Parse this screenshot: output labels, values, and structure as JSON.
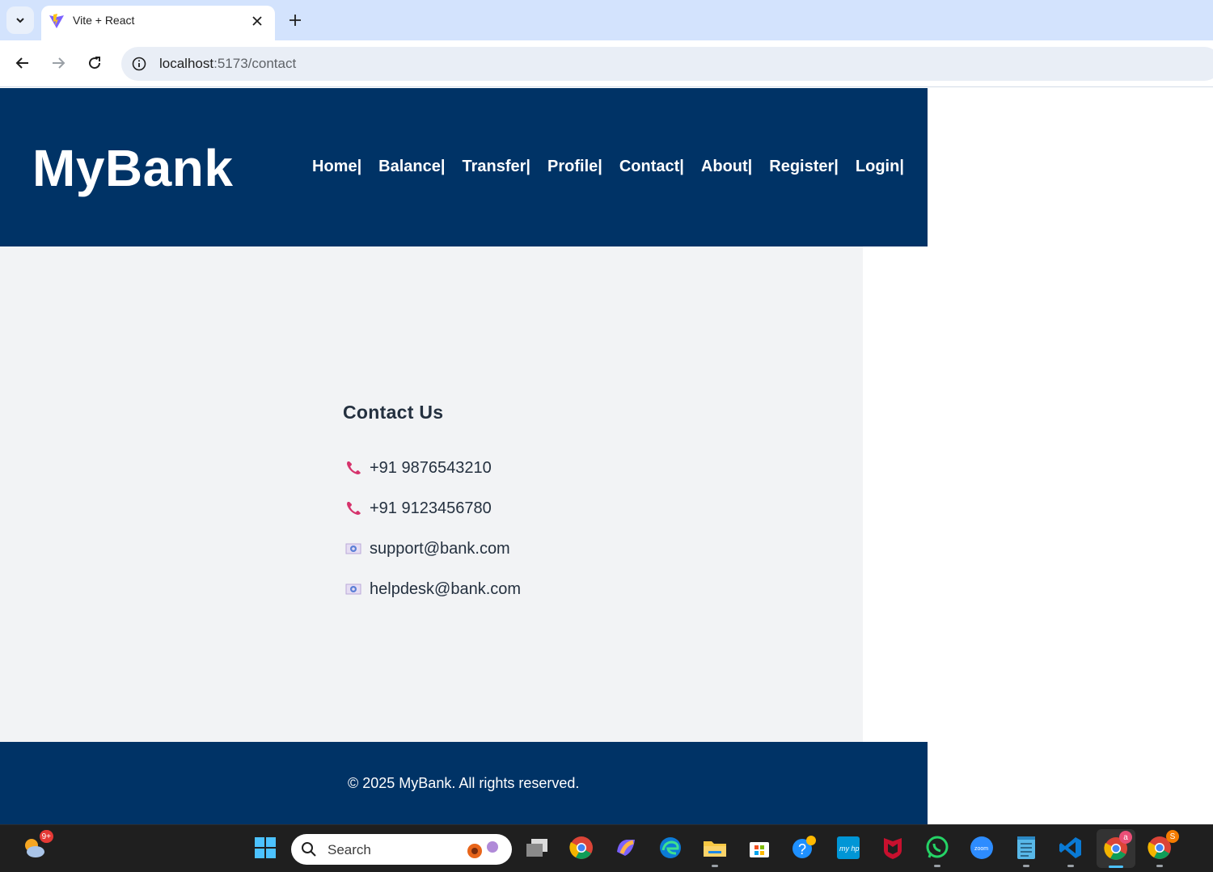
{
  "browser": {
    "tab_title": "Vite + React",
    "url_host": "localhost",
    "url_path": ":5173/contact"
  },
  "header": {
    "logo": "MyBank",
    "nav": [
      "Home|",
      "Balance|",
      "Transfer|",
      "Profile|",
      "Contact|",
      "About|",
      "Register|",
      "Login|"
    ]
  },
  "contact": {
    "title": "Contact Us",
    "phones": [
      "+91 9876543210",
      "+91 9123456780"
    ],
    "emails": [
      "support@bank.com",
      "helpdesk@bank.com"
    ],
    "phone_icon": "telephone-receiver-icon",
    "email_icon": "email-icon"
  },
  "footer": {
    "text": "© 2025 MyBank. All rights reserved."
  },
  "taskbar": {
    "weather_badge": "9+",
    "search_placeholder": "Search",
    "chrome_badge_1": "a",
    "chrome_badge_2": "S"
  },
  "colors": {
    "brand": "#003366",
    "content_bg": "#f2f3f5",
    "phone_icon": "#d6336c"
  }
}
